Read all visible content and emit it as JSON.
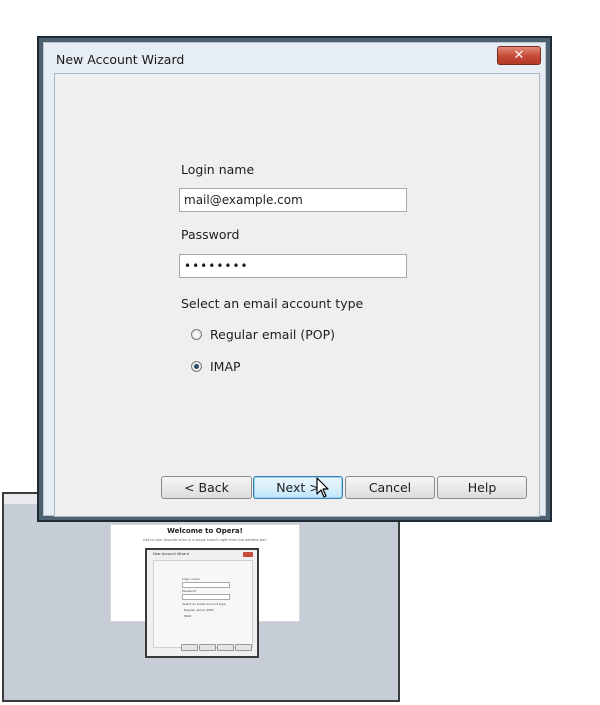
{
  "dialog": {
    "title": "New Account Wizard",
    "close_label": "✕",
    "login_label": "Login name",
    "login_value": "mail@example.com",
    "password_label": "Password",
    "password_value": "••••••••",
    "account_type_label": "Select an email account type",
    "options": [
      {
        "label": "Regular email (POP)",
        "checked": false
      },
      {
        "label": "IMAP",
        "checked": true
      }
    ],
    "buttons": {
      "back": "< Back",
      "next": "Next >",
      "cancel": "Cancel",
      "help": "Help"
    }
  },
  "background": {
    "page_title": "Welcome to Opera!",
    "page_subtitle": "Get to your favorite sites in a single search right from the address bar!"
  },
  "colors": {
    "window_frame": "#4d6171",
    "close_button": "#c44a36",
    "default_button_border": "#3c7fb1"
  }
}
